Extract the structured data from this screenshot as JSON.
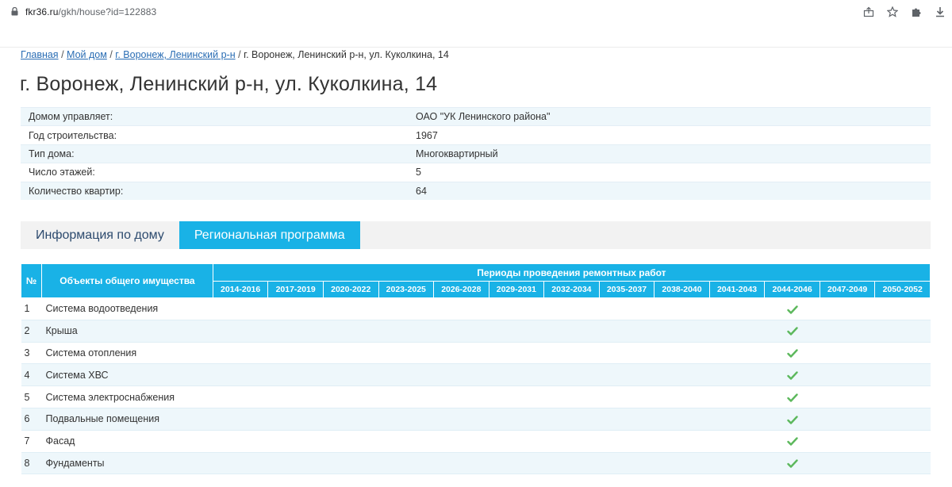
{
  "browser": {
    "url_host": "fkr36.ru",
    "url_path": "/gkh/house?id=122883"
  },
  "breadcrumbs": {
    "home": "Главная",
    "my_house": "Мой дом",
    "district": "г. Воронеж, Ленинский р-н",
    "current": "г. Воронеж, Ленинский р-н, ул. Куколкина, 14"
  },
  "page_title": "г. Воронеж, Ленинский р-н, ул. Куколкина, 14",
  "info": [
    {
      "label": "Домом управляет:",
      "value": "ОАО \"УК Ленинского района\""
    },
    {
      "label": "Год строительства:",
      "value": "1967"
    },
    {
      "label": "Тип дома:",
      "value": "Многоквартирный"
    },
    {
      "label": "Число этажей:",
      "value": "5"
    },
    {
      "label": "Количество квартир:",
      "value": "64"
    }
  ],
  "tabs": [
    {
      "label": "Информация по дому",
      "active": false
    },
    {
      "label": "Региональная программа",
      "active": true
    }
  ],
  "program": {
    "col_no": "№",
    "col_object": "Объекты общего имущества",
    "col_periods": "Периоды проведения ремонтных работ",
    "periods": [
      "2014-2016",
      "2017-2019",
      "2020-2022",
      "2023-2025",
      "2026-2028",
      "2029-2031",
      "2032-2034",
      "2035-2037",
      "2038-2040",
      "2041-2043",
      "2044-2046",
      "2047-2049",
      "2050-2052"
    ],
    "rows": [
      {
        "no": "1",
        "name": "Система водоотведения",
        "period": "2044-2046"
      },
      {
        "no": "2",
        "name": "Крыша",
        "period": "2044-2046"
      },
      {
        "no": "3",
        "name": "Система отопления",
        "period": "2044-2046"
      },
      {
        "no": "4",
        "name": "Система ХВС",
        "period": "2044-2046"
      },
      {
        "no": "5",
        "name": "Система электроснабжения",
        "period": "2044-2046"
      },
      {
        "no": "6",
        "name": "Подвальные помещения",
        "period": "2044-2046"
      },
      {
        "no": "7",
        "name": "Фасад",
        "period": "2044-2046"
      },
      {
        "no": "8",
        "name": "Фундаменты",
        "period": "2044-2046"
      }
    ]
  },
  "colors": {
    "accent": "#19b2e6",
    "check": "#5cb85c",
    "link": "#2a6db4"
  }
}
